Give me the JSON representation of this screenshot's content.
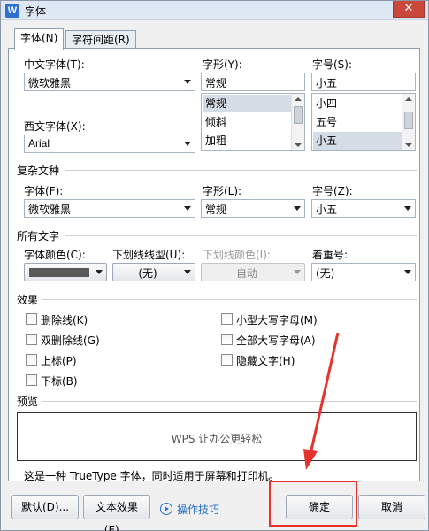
{
  "window": {
    "title": "字体",
    "app_icon": "W",
    "close_label": "✕"
  },
  "tabs": [
    {
      "label": "字体(N)",
      "active": true
    },
    {
      "label": "字符间距(R)",
      "active": false
    }
  ],
  "chinese_font": {
    "label": "中文字体(T):",
    "value": "微软雅黑"
  },
  "style": {
    "label": "字形(Y):",
    "value": "常规",
    "options": [
      "常规",
      "倾斜",
      "加粗"
    ]
  },
  "size": {
    "label": "字号(S):",
    "value": "小五",
    "options": [
      "小四",
      "五号",
      "小五"
    ]
  },
  "western_font": {
    "label": "西文字体(X):",
    "value": "Arial"
  },
  "complex": {
    "section": "复杂文种",
    "font_label": "字体(F):",
    "font_value": "微软雅黑",
    "style_label": "字形(L):",
    "style_value": "常规",
    "size_label": "字号(Z):",
    "size_value": "小五"
  },
  "all_text": {
    "section": "所有文字",
    "color_label": "字体颜色(C):",
    "underline_label": "下划线线型(U):",
    "underline_value": "(无)",
    "underline_color_label": "下划线颜色(I):",
    "underline_color_value": "自动",
    "emphasis_label": "着重号:",
    "emphasis_value": "(无)",
    "font_color": "#5a5a5a"
  },
  "effects": {
    "section": "效果",
    "left": [
      "删除线(K)",
      "双删除线(G)",
      "上标(P)",
      "下标(B)"
    ],
    "right": [
      "小型大写字母(M)",
      "全部大写字母(A)",
      "隐藏文字(H)"
    ]
  },
  "preview": {
    "section": "预览",
    "text": "WPS 让办公更轻松",
    "note": "这是一种 TrueType 字体，同时适用于屏幕和打印机。"
  },
  "buttons": {
    "default": "默认(D)...",
    "text_effect": "文本效果(E)...",
    "tips": "操作技巧",
    "ok": "确定",
    "cancel": "取消"
  },
  "colors": {
    "highlight": "#e5322d",
    "link": "#2a6fc9",
    "selected_item": "#d4dce6"
  }
}
